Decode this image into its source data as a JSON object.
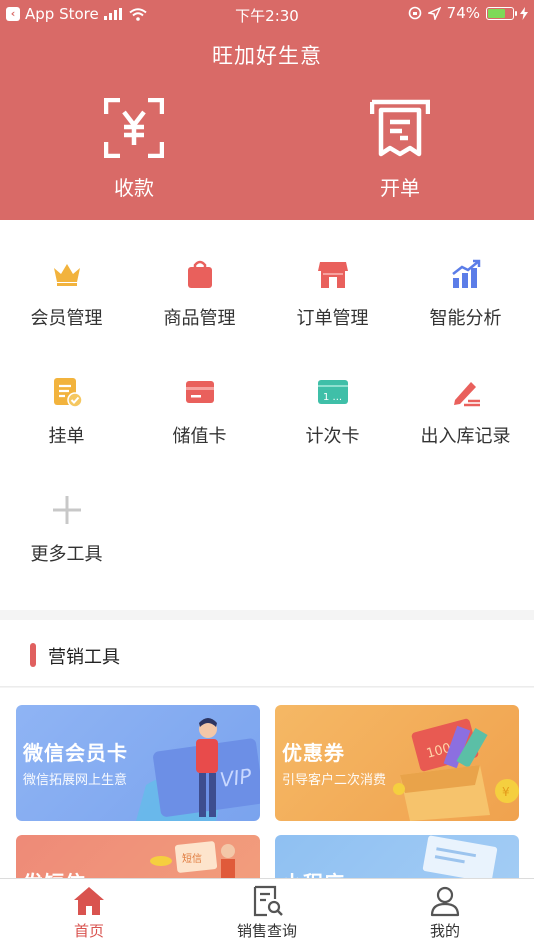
{
  "status_bar": {
    "back_app": "App Store",
    "time": "下午2:30",
    "battery": "74%",
    "battery_level": 0.74
  },
  "header": {
    "title": "旺加好生意",
    "collect_label": "收款",
    "order_label": "开单"
  },
  "tools": [
    {
      "label": "会员管理",
      "icon": "crown-icon",
      "color": "#f2b33d"
    },
    {
      "label": "商品管理",
      "icon": "bag-icon",
      "color": "#e9605c"
    },
    {
      "label": "订单管理",
      "icon": "store-icon",
      "color": "#e9605c"
    },
    {
      "label": "智能分析",
      "icon": "chart-icon",
      "color": "#5b7de8"
    },
    {
      "label": "挂单",
      "icon": "pending-note-icon",
      "color": "#f2b33d"
    },
    {
      "label": "储值卡",
      "icon": "card-icon",
      "color": "#e9605c"
    },
    {
      "label": "计次卡",
      "icon": "count-card-icon",
      "color": "#3fbfa8"
    },
    {
      "label": "出入库记录",
      "icon": "pen-record-icon",
      "color": "#e9605c"
    },
    {
      "label": "更多工具",
      "icon": "plus-icon",
      "color": "#c8c8c8"
    }
  ],
  "marketing": {
    "title": "营销工具",
    "cards": [
      {
        "title": "微信会员卡",
        "subtitle": "微信拓展网上生意",
        "badge": "VIP"
      },
      {
        "title": "优惠券",
        "subtitle": "引导客户二次消费",
        "badge": "100"
      },
      {
        "title": "发短信",
        "subtitle": "",
        "badge": "短信"
      },
      {
        "title": "小程序",
        "subtitle": "",
        "badge": ""
      }
    ]
  },
  "tabbar": {
    "home": "首页",
    "sales": "销售查询",
    "mine": "我的"
  }
}
